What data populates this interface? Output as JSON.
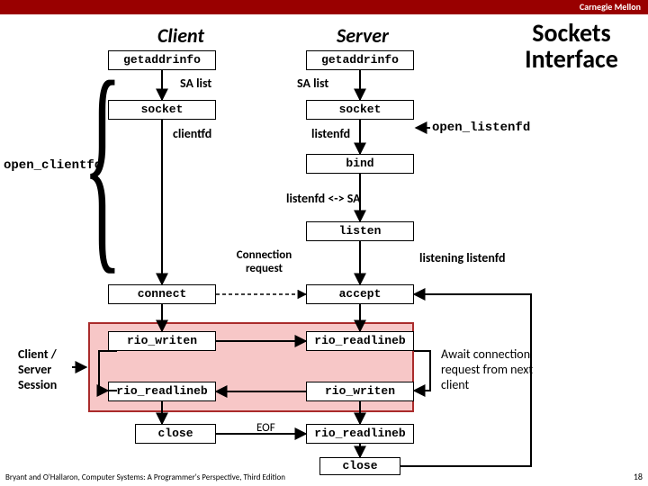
{
  "brand": "Carnegie Mellon",
  "title": "Sockets Interface",
  "columns": {
    "client": "Client",
    "server": "Server"
  },
  "labels": {
    "sa_list_c": "SA list",
    "sa_list_s": "SA list",
    "clientfd": "clientfd",
    "listenfd": "listenfd",
    "listenfd_sa": "listenfd <-> SA",
    "connection_request": "Connection request",
    "listening_listenfd": "listening listenfd",
    "eof": "EOF",
    "open_clientfd": "open_clientfd",
    "open_listenfd": "open_listenfd",
    "await": "Await connection request from next client",
    "session": "Client / Server Session"
  },
  "client_boxes": {
    "getaddrinfo": "getaddrinfo",
    "socket": "socket",
    "connect": "connect",
    "rio_writen": "rio_writen",
    "rio_readlineb": "rio_readlineb",
    "close": "close"
  },
  "server_boxes": {
    "getaddrinfo": "getaddrinfo",
    "socket": "socket",
    "bind": "bind",
    "listen": "listen",
    "accept": "accept",
    "rio_readlineb": "rio_readlineb",
    "rio_writen": "rio_writen",
    "rio_readlineb2": "rio_readlineb",
    "close": "close"
  },
  "footer": "Bryant and O'Hallaron, Computer Systems: A Programmer's Perspective, Third Edition",
  "page": "18"
}
